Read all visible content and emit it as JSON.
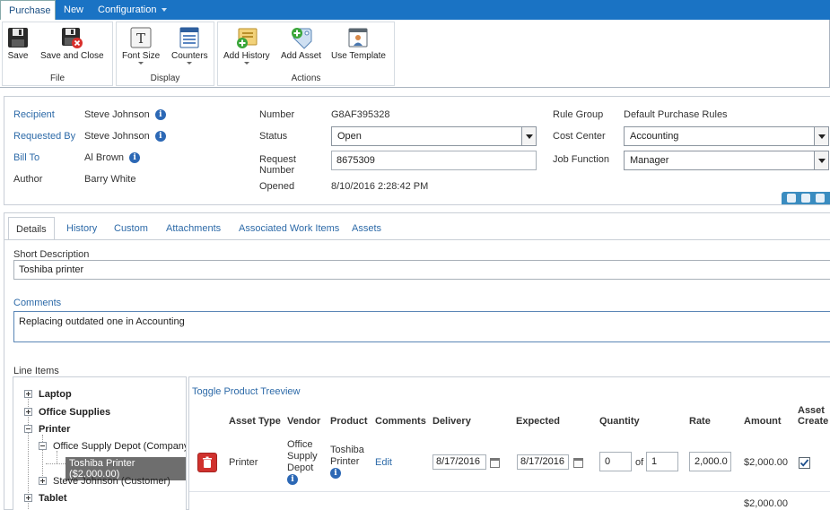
{
  "ribbon": {
    "tabs": [
      {
        "label": "Purchase",
        "active": true
      },
      {
        "label": "New",
        "active": false
      },
      {
        "label": "Configuration",
        "active": false
      }
    ],
    "groups": {
      "file": {
        "label": "File",
        "buttons": {
          "save": "Save",
          "save_close": "Save and Close"
        }
      },
      "display": {
        "label": "Display",
        "buttons": {
          "font_size": "Font Size",
          "counters": "Counters"
        }
      },
      "actions": {
        "label": "Actions",
        "buttons": {
          "add_history": "Add History",
          "add_asset": "Add Asset",
          "use_template": "Use Template"
        }
      }
    }
  },
  "header": {
    "recipient": {
      "label": "Recipient",
      "value": "Steve Johnson"
    },
    "requested_by": {
      "label": "Requested By",
      "value": "Steve Johnson"
    },
    "bill_to": {
      "label": "Bill To",
      "value": "Al Brown"
    },
    "author": {
      "label": "Author",
      "value": "Barry White"
    },
    "number": {
      "label": "Number",
      "value": "G8AF395328"
    },
    "status": {
      "label": "Status",
      "value": "Open"
    },
    "request_number": {
      "label_line1": "Request",
      "label_line2": "Number",
      "value": "8675309"
    },
    "opened": {
      "label": "Opened",
      "value": "8/10/2016 2:28:42 PM"
    },
    "rule_group": {
      "label": "Rule Group",
      "value": "Default Purchase Rules"
    },
    "cost_center": {
      "label": "Cost Center",
      "value": "Accounting"
    },
    "job_function": {
      "label": "Job Function",
      "value": "Manager"
    }
  },
  "detail_tabs": [
    {
      "label": "Details",
      "active": true
    },
    {
      "label": "History",
      "active": false
    },
    {
      "label": "Custom",
      "active": false
    },
    {
      "label": "Attachments",
      "active": false
    },
    {
      "label": "Associated Work Items",
      "active": false
    },
    {
      "label": "Assets",
      "active": false
    }
  ],
  "short_description": {
    "label": "Short Description",
    "value": "Toshiba printer"
  },
  "comments": {
    "label": "Comments",
    "value": "Replacing outdated one in Accounting"
  },
  "line_items": {
    "label": "Line Items",
    "toggle_link": "Toggle Product Treeview",
    "tree": {
      "laptop": "Laptop",
      "office_supplies": "Office Supplies",
      "printer": "Printer",
      "office_supply_depot": "Office Supply Depot (Company)",
      "toshiba_printer": "Toshiba Printer ($2,000.00)",
      "steve_johnson": "Steve Johnson (Customer)",
      "tablet": "Tablet"
    },
    "columns": {
      "asset_type": "Asset Type",
      "vendor": "Vendor",
      "product": "Product",
      "comments": "Comments",
      "delivery": "Delivery",
      "expected": "Expected",
      "quantity": "Quantity",
      "rate": "Rate",
      "amount": "Amount",
      "asset_create_1": "Asset",
      "asset_create_2": "Create"
    },
    "row": {
      "asset_type": "Printer",
      "vendor_1": "Office",
      "vendor_2": "Supply",
      "vendor_3": "Depot",
      "product_1": "Toshiba",
      "product_2": "Printer",
      "comments_link": "Edit",
      "delivery": "8/17/2016",
      "expected": "8/17/2016",
      "quantity": "0",
      "of_label": "of",
      "quantity_total": "1",
      "rate": "2,000.0",
      "amount": "$2,000.00",
      "asset_create": true
    },
    "total": "$2,000.00"
  }
}
